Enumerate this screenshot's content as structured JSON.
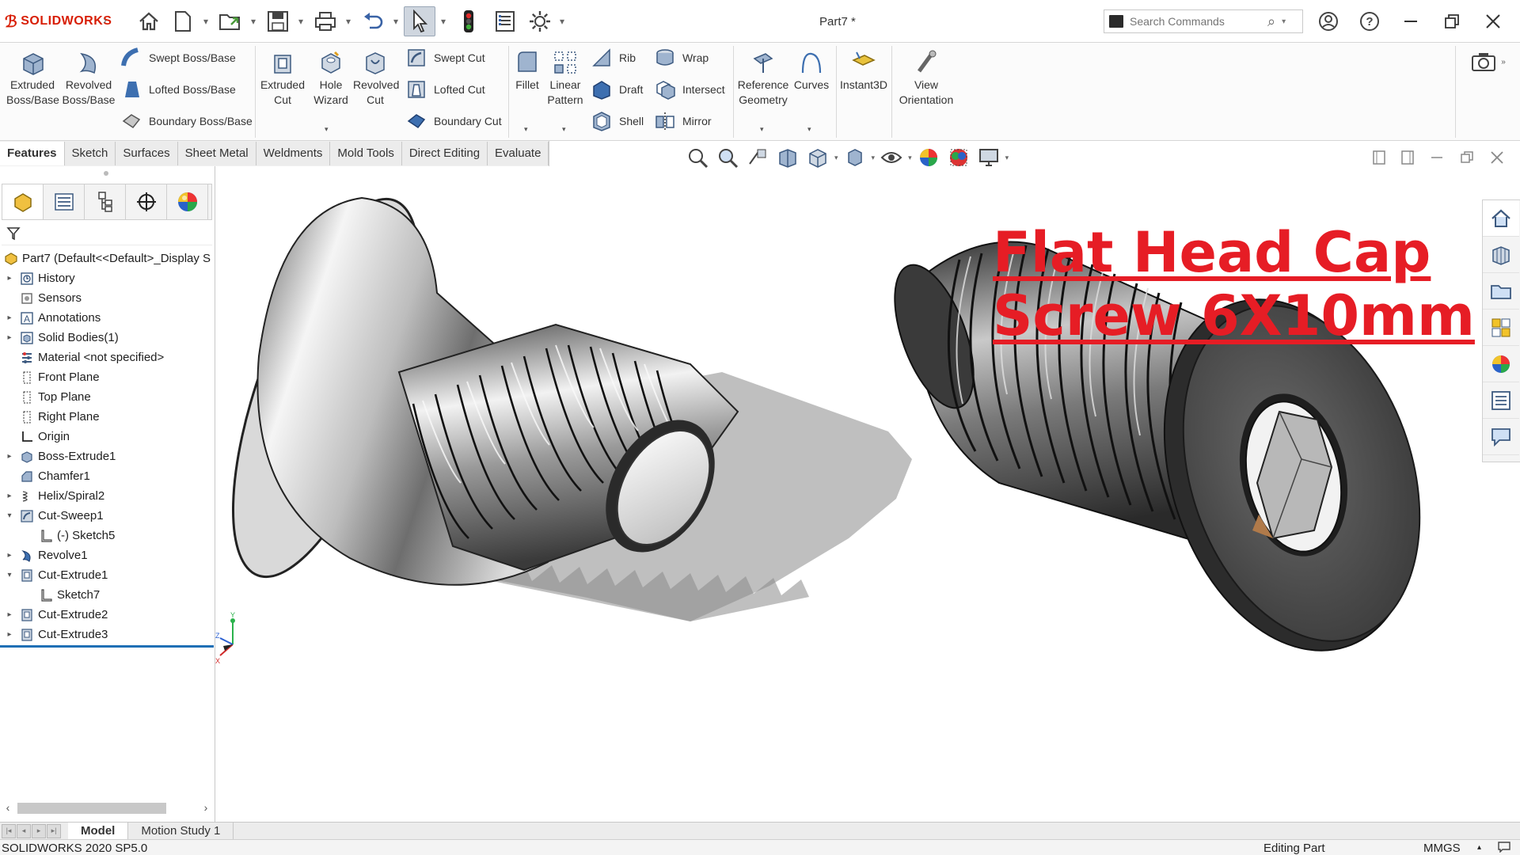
{
  "app": {
    "brand": "SOLIDWORKS",
    "document_title": "Part7 *"
  },
  "search": {
    "placeholder": "Search Commands"
  },
  "ribbon": {
    "extruded_boss": "Extruded Boss/Base",
    "revolved_boss": "Revolved Boss/Base",
    "swept_boss": "Swept Boss/Base",
    "lofted_boss": "Lofted Boss/Base",
    "boundary_boss": "Boundary Boss/Base",
    "extruded_cut": "Extruded Cut",
    "hole_wizard": "Hole Wizard",
    "revolved_cut": "Revolved Cut",
    "swept_cut": "Swept Cut",
    "lofted_cut": "Lofted Cut",
    "boundary_cut": "Boundary Cut",
    "fillet": "Fillet",
    "linear_pattern": "Linear Pattern",
    "rib": "Rib",
    "draft": "Draft",
    "shell": "Shell",
    "wrap": "Wrap",
    "intersect": "Intersect",
    "mirror": "Mirror",
    "reference_geometry": "Reference Geometry",
    "curves": "Curves",
    "instant3d": "Instant3D",
    "view_orientation": "View Orientation"
  },
  "tabs": [
    "Features",
    "Sketch",
    "Surfaces",
    "Sheet Metal",
    "Weldments",
    "Mold Tools",
    "Direct Editing",
    "Evaluate"
  ],
  "tree": {
    "root": "Part7  (Default<<Default>_Display S",
    "items": [
      {
        "label": "History",
        "icon": "history-icon"
      },
      {
        "label": "Sensors",
        "icon": "sensors-icon"
      },
      {
        "label": "Annotations",
        "icon": "annotations-icon"
      },
      {
        "label": "Solid Bodies(1)",
        "icon": "solid-bodies-icon"
      },
      {
        "label": "Material <not specified>",
        "icon": "material-icon"
      },
      {
        "label": "Front Plane",
        "icon": "plane-icon"
      },
      {
        "label": "Top Plane",
        "icon": "plane-icon"
      },
      {
        "label": "Right Plane",
        "icon": "plane-icon"
      },
      {
        "label": "Origin",
        "icon": "origin-icon"
      },
      {
        "label": "Boss-Extrude1",
        "icon": "extrude-icon"
      },
      {
        "label": "Chamfer1",
        "icon": "chamfer-icon"
      },
      {
        "label": "Helix/Spiral2",
        "icon": "helix-icon"
      },
      {
        "label": "Cut-Sweep1",
        "icon": "cut-sweep-icon"
      },
      {
        "label": "(-) Sketch5",
        "icon": "sketch-icon"
      },
      {
        "label": "Revolve1",
        "icon": "revolve-icon"
      },
      {
        "label": "Cut-Extrude1",
        "icon": "cut-extrude-icon"
      },
      {
        "label": "Sketch7",
        "icon": "sketch-icon"
      },
      {
        "label": "Cut-Extrude2",
        "icon": "cut-extrude-icon"
      },
      {
        "label": "Cut-Extrude3",
        "icon": "cut-extrude-icon"
      }
    ]
  },
  "overlay": {
    "line1": "Flat Head Cap",
    "line2": "Screw 6X10mm",
    "color": "#e61d25"
  },
  "triad": {
    "x": "X",
    "y": "Y",
    "z": "Z"
  },
  "bottom_tabs": [
    "Model",
    "Motion Study 1"
  ],
  "status": {
    "version": "SOLIDWORKS 2020 SP5.0",
    "mode": "Editing Part",
    "units": "MMGS"
  },
  "colors": {
    "brand": "#d81e05",
    "accent": "#1f6fb5"
  }
}
